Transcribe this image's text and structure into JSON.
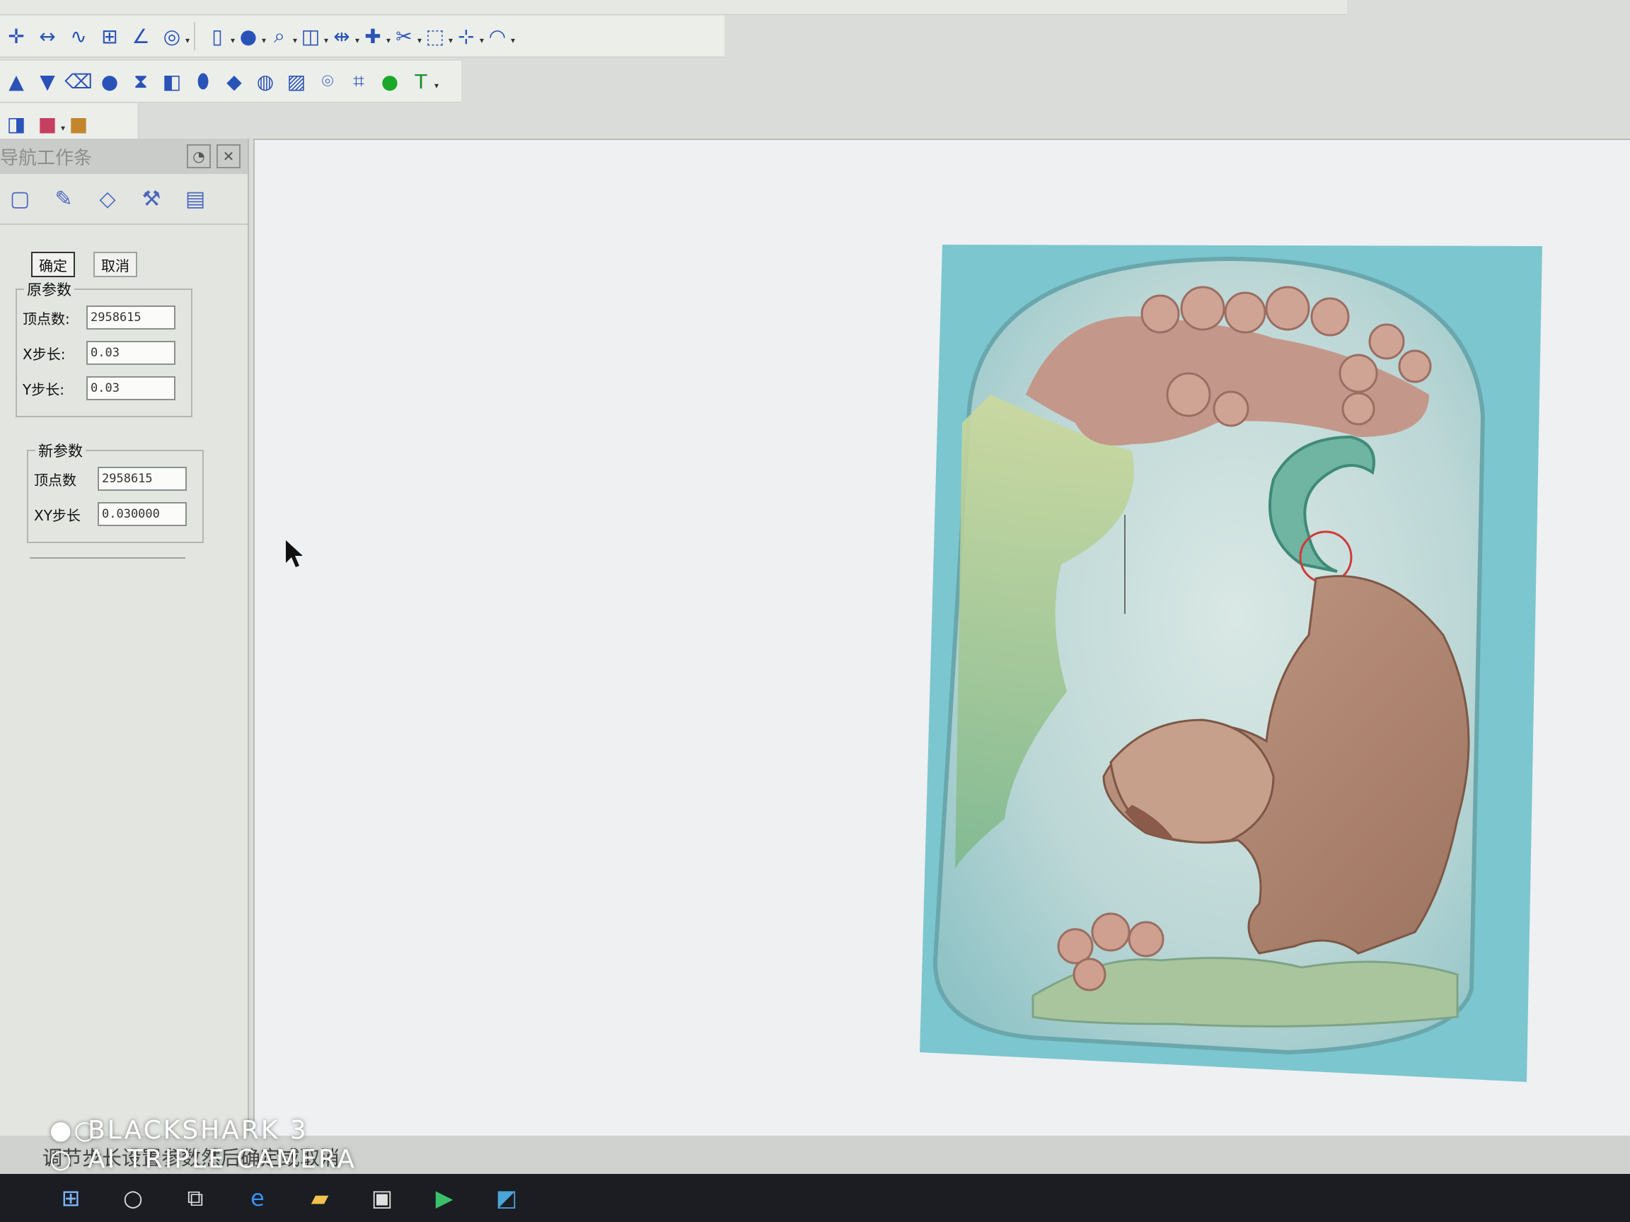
{
  "navigator": {
    "title": "导航工作条",
    "confirm_label": "确定",
    "cancel_label": "取消",
    "original_params": {
      "legend": "原参数",
      "vertex_label": "顶点数:",
      "vertex_value": "2958615",
      "x_step_label": "X步长:",
      "x_step_value": "0.03",
      "y_step_label": "Y步长:",
      "y_step_value": "0.03"
    },
    "new_params": {
      "legend": "新参数",
      "vertex_label": "顶点数",
      "vertex_value": "2958615",
      "xy_step_label": "XY步长",
      "xy_step_value": "0.030000"
    }
  },
  "status_bar": {
    "text": "调节步长设置参数然后确定或取消"
  },
  "camera_watermark": {
    "line1": "BLACKSHARK 3",
    "line2": "AI TRIPLE CAMERA"
  },
  "colors": {
    "relief_background": "#7cc6cf",
    "relief_tile": "#bdd9d9",
    "tiger_body": "#b98b76",
    "tiger_tail": "#6fb5a1",
    "pine_flowers": "#c99a8d",
    "grass_left": "#9cc58d"
  }
}
